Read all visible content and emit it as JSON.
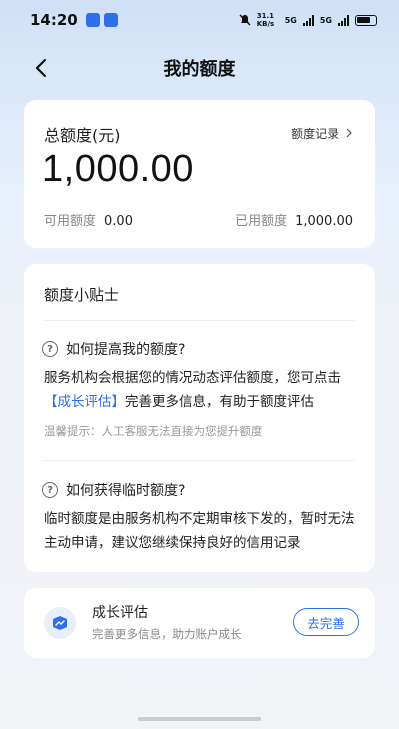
{
  "status_bar": {
    "time": "14:20",
    "network_speed": "31.1 KB/s",
    "signal_1": "5G",
    "signal_2": "5G"
  },
  "nav": {
    "title": "我的额度",
    "back_icon": "chevron-left-icon"
  },
  "quota": {
    "label": "总额度(元)",
    "records_link": "额度记录",
    "amount": "1,000.00",
    "available_label": "可用额度",
    "available_value": "0.00",
    "used_label": "已用额度",
    "used_value": "1,000.00"
  },
  "tips": {
    "title": "额度小贴士",
    "items": [
      {
        "question": "如何提高我的额度?",
        "answer_pre": "服务机构会根据您的情况动态评估额度，您可点击",
        "answer_link": "【成长评估】",
        "answer_post": "完善更多信息，有助于额度评估",
        "hint": "温馨提示：人工客服无法直接为您提升额度"
      },
      {
        "question": "如何获得临时额度?",
        "answer": "临时额度是由服务机构不定期审核下发的，暂时无法主动申请，建议您继续保持良好的信用记录"
      }
    ]
  },
  "growth": {
    "title": "成长评估",
    "subtitle": "完善更多信息，助力账户成长",
    "button": "去完善"
  },
  "colors": {
    "accent": "#2f6fe8",
    "background_top": "#cfe0f7",
    "muted_text": "#888888"
  }
}
